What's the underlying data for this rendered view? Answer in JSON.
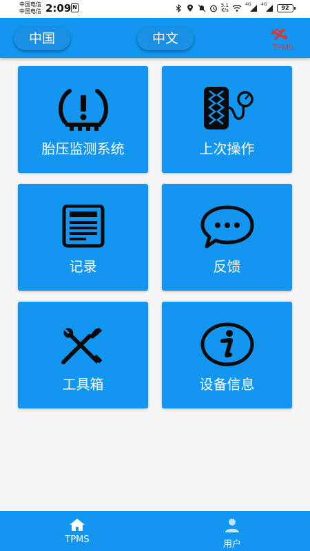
{
  "status_bar": {
    "carrier_1": "中国电信",
    "carrier_2": "中国电信",
    "time": "2:09",
    "nfc": "N",
    "speed_value": "5.1",
    "speed_unit": "K/s",
    "signal_1_label": "4G",
    "signal_2_label": "4G",
    "battery": "92"
  },
  "header": {
    "country_button": "中国",
    "language_button": "中文",
    "brand_text": "TPMS"
  },
  "tiles": [
    {
      "label": "胎压监测系统",
      "icon": "tire-pressure-warning-icon"
    },
    {
      "label": "上次操作",
      "icon": "tire-gauge-icon"
    },
    {
      "label": "记录",
      "icon": "document-icon"
    },
    {
      "label": "反馈",
      "icon": "chat-bubble-icon"
    },
    {
      "label": "工具箱",
      "icon": "wrench-screwdriver-icon"
    },
    {
      "label": "设备信息",
      "icon": "info-icon"
    }
  ],
  "bottom_nav": [
    {
      "label": "TPMS",
      "icon": "home-icon"
    },
    {
      "label": "用户",
      "icon": "user-icon"
    }
  ],
  "colors": {
    "primary": "#1296f0",
    "brand_red": "#e5342d",
    "icon_dark": "#0a0a0a"
  }
}
